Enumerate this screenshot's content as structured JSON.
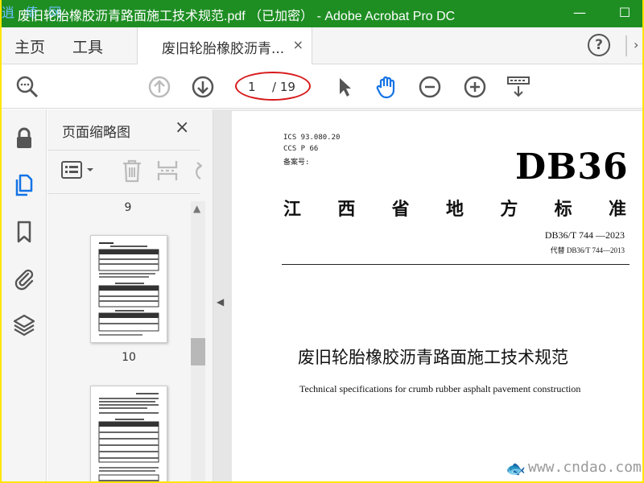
{
  "window": {
    "title": "废旧轮胎橡胶沥青路面施工技术规范.pdf （已加密） - Adobe Acrobat Pro DC",
    "watermark": "逍 倚 网",
    "minimize": "—",
    "maximize": "☐"
  },
  "tabs": {
    "home": "主页",
    "tools": "工具",
    "document": "废旧轮胎橡胶沥青...",
    "document_close": "×",
    "help": "?"
  },
  "toolbar": {
    "current_page": "1",
    "total_pages": "/ 19",
    "colors": {
      "accent": "#1473e6",
      "annotation": "#d8191b"
    }
  },
  "sidebar": {
    "rail_items": [
      "lock-icon",
      "pages-icon",
      "bookmark-icon",
      "attachment-icon",
      "layers-icon"
    ]
  },
  "thumbnails_panel": {
    "title": "页面缩略图",
    "close": "×",
    "page_labels": [
      "9",
      "10"
    ]
  },
  "document": {
    "ics": "ICS 93.080.20",
    "ccs": "CCS P 66",
    "record": "备案号:",
    "brand": "DB36",
    "standard_chars": [
      "江",
      "西",
      "省",
      "地",
      "方",
      "标",
      "准"
    ],
    "code": "DB36/T 744 —2023",
    "replaces": "代替 DB36/T 744—2013",
    "title_cn": "废旧轮胎橡胶沥青路面施工技术规范",
    "title_en": "Technical specifications for crumb rubber asphalt pavement construction",
    "site": "www.cndao.com",
    "site_mark": "🐟"
  }
}
